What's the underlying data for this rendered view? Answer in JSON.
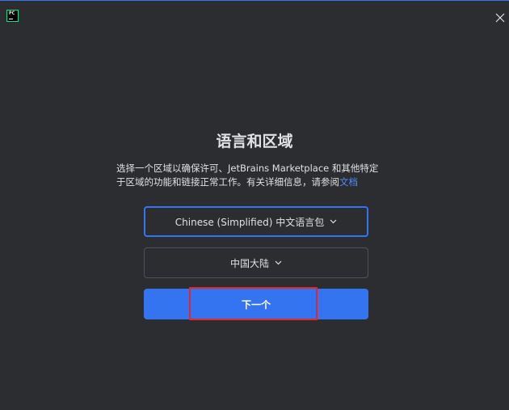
{
  "app": {
    "icon_name": "pycharm-logo-icon",
    "icon_text": "PC"
  },
  "window": {
    "close_icon": "close-icon"
  },
  "main": {
    "title": "语言和区域",
    "description_line1": "选择一个区域以确保许可、JetBrains Marketplace 和其他特定",
    "description_line2": "于区域的功能和链接正常工作。有关详细信息，请参阅",
    "description_link": "文档",
    "language_select": {
      "value": "Chinese (Simplified) 中文语言包"
    },
    "region_select": {
      "value": "中国大陆"
    },
    "next_button": "下一个"
  },
  "colors": {
    "background": "#2b2d30",
    "accent": "#3574f0",
    "link": "#548af7",
    "highlight": "#e02a2a"
  }
}
